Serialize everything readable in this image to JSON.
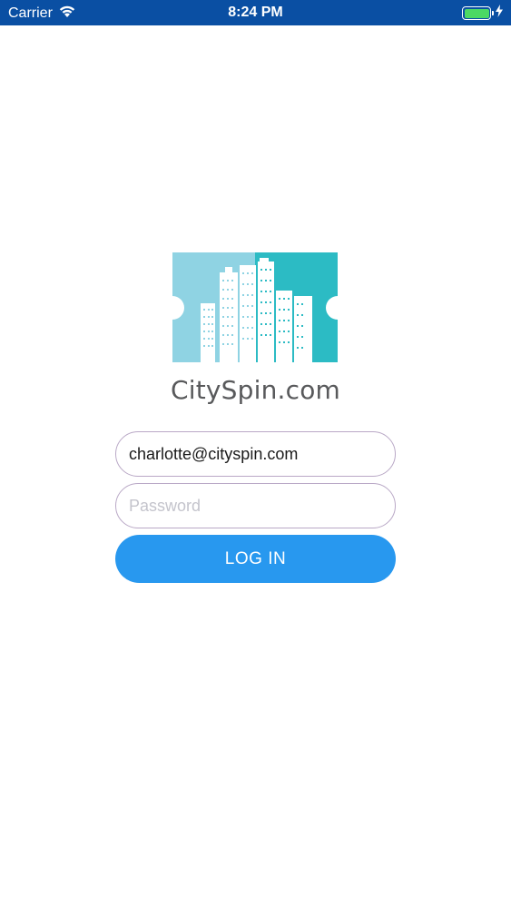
{
  "status_bar": {
    "carrier": "Carrier",
    "time": "8:24 PM",
    "battery_color": "#4cd964",
    "icons": [
      "wifi-icon",
      "battery-icon",
      "charging-bolt-icon"
    ]
  },
  "brand": {
    "name": "CitySpin.com",
    "logo_colors": [
      "#8fd3e3",
      "#2cbbc4"
    ]
  },
  "login_form": {
    "email_value": "charlotte@cityspin.com",
    "password_placeholder": "Password",
    "login_label": "LOG IN",
    "button_color": "#2898ef"
  }
}
